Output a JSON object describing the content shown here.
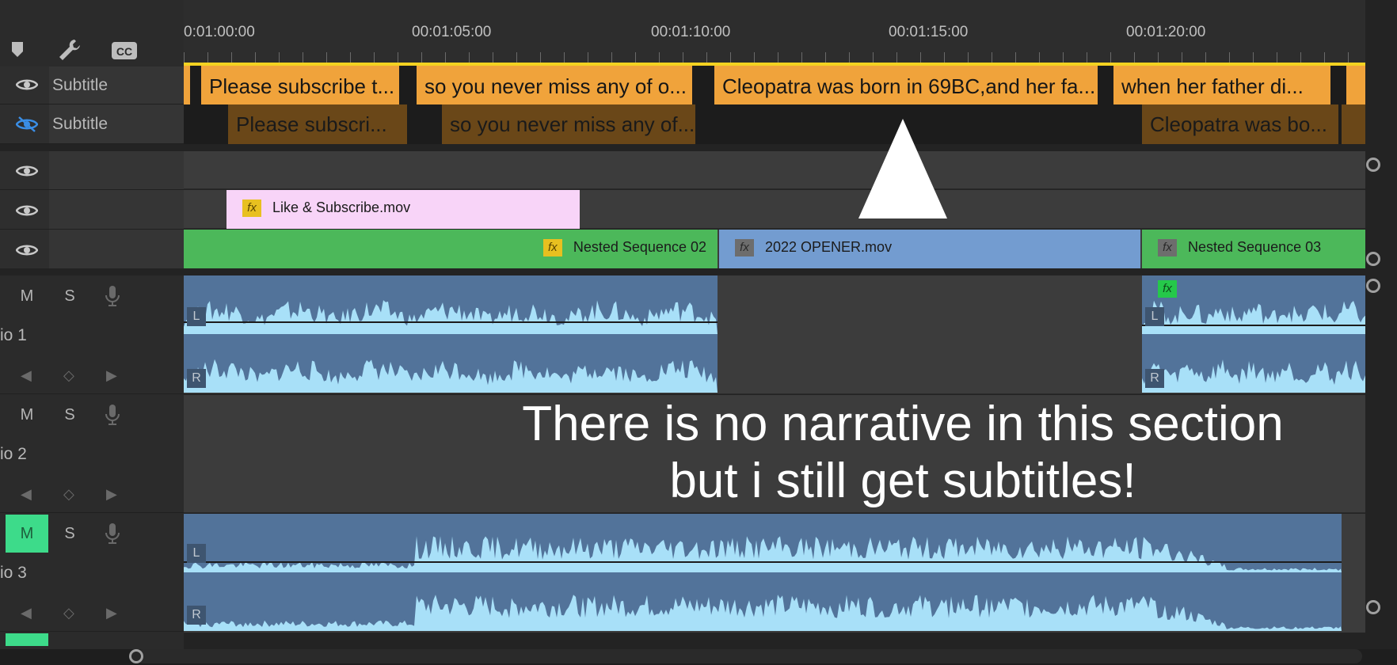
{
  "ruler": {
    "timecodes": [
      "0:01:00:00",
      "00:01:05:00",
      "00:01:10:00",
      "00:01:15:00",
      "00:01:20:00"
    ]
  },
  "tracks": {
    "subtitle_1": {
      "label": "Subtitle"
    },
    "subtitle_2": {
      "label": "Subtitle"
    },
    "audio_1": {
      "name": "io 1"
    },
    "audio_2": {
      "name": "io 2"
    },
    "audio_3": {
      "name": "io 3"
    },
    "mute_label": "M",
    "solo_label": "S",
    "channel_left": "L",
    "channel_right": "R"
  },
  "captions_track_1": [
    "Please subscribe t...",
    "so you never miss any of o...",
    "Cleopatra was born in 69BC,and her fa...",
    "when her father di..."
  ],
  "captions_track_2": [
    "Please subscri...",
    "so you never miss any of...",
    "Cleopatra was bo..."
  ],
  "video_clips": {
    "v3": "Like & Subscribe.mov",
    "v1_a": "Nested Sequence 02",
    "v1_b": "2022 OPENER.mov",
    "v1_c": "Nested Sequence 03",
    "fx_label": "fx"
  },
  "overlay": {
    "line1": "There is no narrative in this section",
    "line2": "but i still get subtitles!"
  },
  "colors": {
    "caption_active": "#f0a33b",
    "caption_inactive": "#6a4718",
    "video_pink": "#f8d4f8",
    "video_green": "#4cb85a",
    "video_blue": "#739cd0",
    "audio_clip": "#52739a",
    "waveform": "#a8e0f8",
    "work_area": "#f4d221",
    "mute_active": "#3ddb8a"
  }
}
